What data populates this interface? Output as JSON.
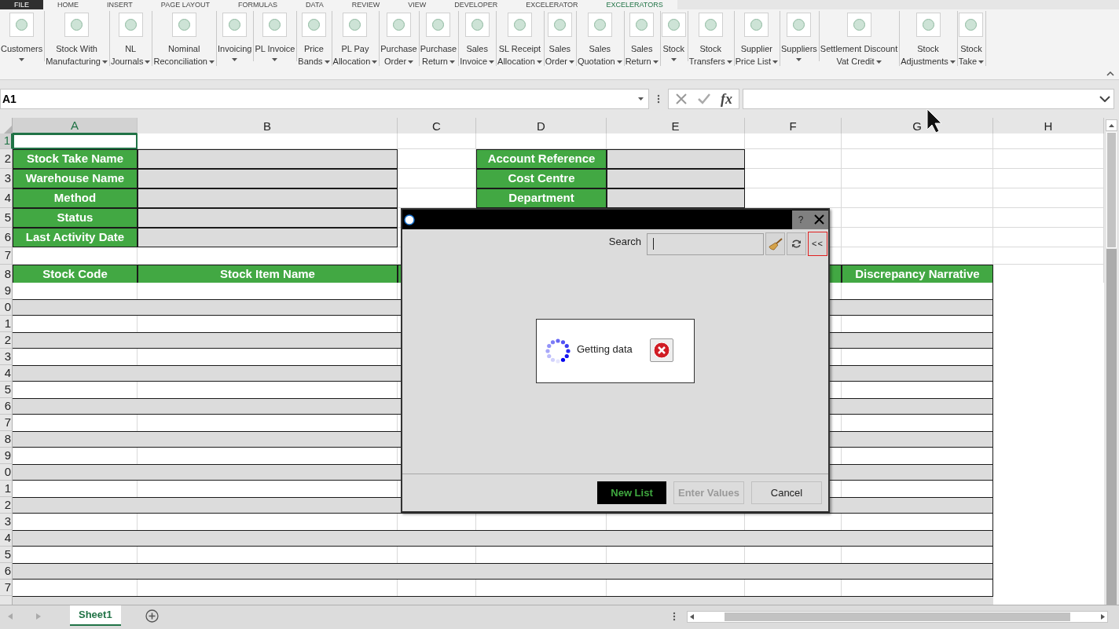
{
  "ribbon_tabs": [
    {
      "label": "FILE",
      "selected": false
    },
    {
      "label": "HOME",
      "selected": false
    },
    {
      "label": "INSERT",
      "selected": false
    },
    {
      "label": "PAGE LAYOUT",
      "selected": false
    },
    {
      "label": "FORMULAS",
      "selected": false
    },
    {
      "label": "DATA",
      "selected": false
    },
    {
      "label": "REVIEW",
      "selected": false
    },
    {
      "label": "VIEW",
      "selected": false
    },
    {
      "label": "DEVELOPER",
      "selected": false
    },
    {
      "label": "EXCELERATOR",
      "selected": false
    },
    {
      "label": "EXCELERATORS",
      "selected": true
    }
  ],
  "ribbon_buttons": [
    {
      "lines": [
        "Customers"
      ]
    },
    {
      "lines": [
        "Stock With",
        "Manufacturing"
      ]
    },
    {
      "lines": [
        "NL",
        "Journals"
      ]
    },
    {
      "lines": [
        "Nominal",
        "Reconciliation"
      ]
    },
    {
      "lines": [
        "Invoicing"
      ]
    },
    {
      "lines": [
        "PL Invoice"
      ]
    },
    {
      "lines": [
        "Price",
        "Bands"
      ]
    },
    {
      "lines": [
        "PL Pay",
        "Allocation"
      ]
    },
    {
      "lines": [
        "Purchase",
        "Order"
      ]
    },
    {
      "lines": [
        "Purchase",
        "Return"
      ]
    },
    {
      "lines": [
        "Sales",
        "Invoice"
      ]
    },
    {
      "lines": [
        "SL Receipt",
        "Allocation"
      ]
    },
    {
      "lines": [
        "Sales",
        "Order"
      ]
    },
    {
      "lines": [
        "Sales",
        "Quotation"
      ]
    },
    {
      "lines": [
        "Sales",
        "Return"
      ]
    },
    {
      "lines": [
        "Stock"
      ]
    },
    {
      "lines": [
        "Stock",
        "Transfers"
      ]
    },
    {
      "lines": [
        "Supplier",
        "Price List"
      ]
    },
    {
      "lines": [
        "Suppliers"
      ]
    },
    {
      "lines": [
        "Settlement Discount",
        "Vat Credit"
      ]
    },
    {
      "lines": [
        "Stock",
        "Adjustments"
      ]
    },
    {
      "lines": [
        "Stock",
        "Take"
      ]
    }
  ],
  "name_box": "A1",
  "function_label": "fx",
  "columns": [
    {
      "label": "A",
      "selected": true
    },
    {
      "label": "B",
      "selected": false
    },
    {
      "label": "C",
      "selected": false
    },
    {
      "label": "D",
      "selected": false
    },
    {
      "label": "E",
      "selected": false
    },
    {
      "label": "F",
      "selected": false
    },
    {
      "label": "G",
      "selected": false
    },
    {
      "label": "H",
      "selected": false
    }
  ],
  "row_numbers": [
    {
      "label": "1",
      "selected": true
    },
    {
      "label": "2",
      "selected": false
    },
    {
      "label": "3",
      "selected": false
    },
    {
      "label": "4",
      "selected": false
    },
    {
      "label": "5",
      "selected": false
    },
    {
      "label": "6",
      "selected": false
    },
    {
      "label": "7",
      "selected": false
    },
    {
      "label": "8",
      "selected": false
    },
    {
      "label": "9",
      "selected": false
    },
    {
      "label": "0",
      "selected": false
    },
    {
      "label": "1",
      "selected": false
    },
    {
      "label": "2",
      "selected": false
    },
    {
      "label": "3",
      "selected": false
    },
    {
      "label": "4",
      "selected": false
    },
    {
      "label": "5",
      "selected": false
    },
    {
      "label": "6",
      "selected": false
    },
    {
      "label": "7",
      "selected": false
    },
    {
      "label": "8",
      "selected": false
    },
    {
      "label": "9",
      "selected": false
    },
    {
      "label": "0",
      "selected": false
    },
    {
      "label": "1",
      "selected": false
    },
    {
      "label": "2",
      "selected": false
    },
    {
      "label": "3",
      "selected": false
    },
    {
      "label": "4",
      "selected": false
    },
    {
      "label": "5",
      "selected": false
    },
    {
      "label": "6",
      "selected": false
    },
    {
      "label": "7",
      "selected": false
    }
  ],
  "form_left": [
    "Stock Take Name",
    "Warehouse Name",
    "Method",
    "Status",
    "Last Activity Date"
  ],
  "form_right": [
    "Account Reference",
    "Cost Centre",
    "Department"
  ],
  "table_headers": {
    "column_a": "Stock Code",
    "column_b": "Stock Item Name",
    "column_g": "Discrepancy Narrative"
  },
  "dialog": {
    "help": "?",
    "search_label": "Search",
    "collapse": "<<",
    "loading_message": "Getting data",
    "buttons": [
      {
        "label": "New List",
        "kind": "primary",
        "disabled": false
      },
      {
        "label": "Enter Values",
        "kind": "normal",
        "disabled": true
      },
      {
        "label": "Cancel",
        "kind": "normal",
        "disabled": false
      }
    ]
  },
  "sheet_tabs": [
    {
      "label": "Sheet1",
      "selected": true
    }
  ]
}
